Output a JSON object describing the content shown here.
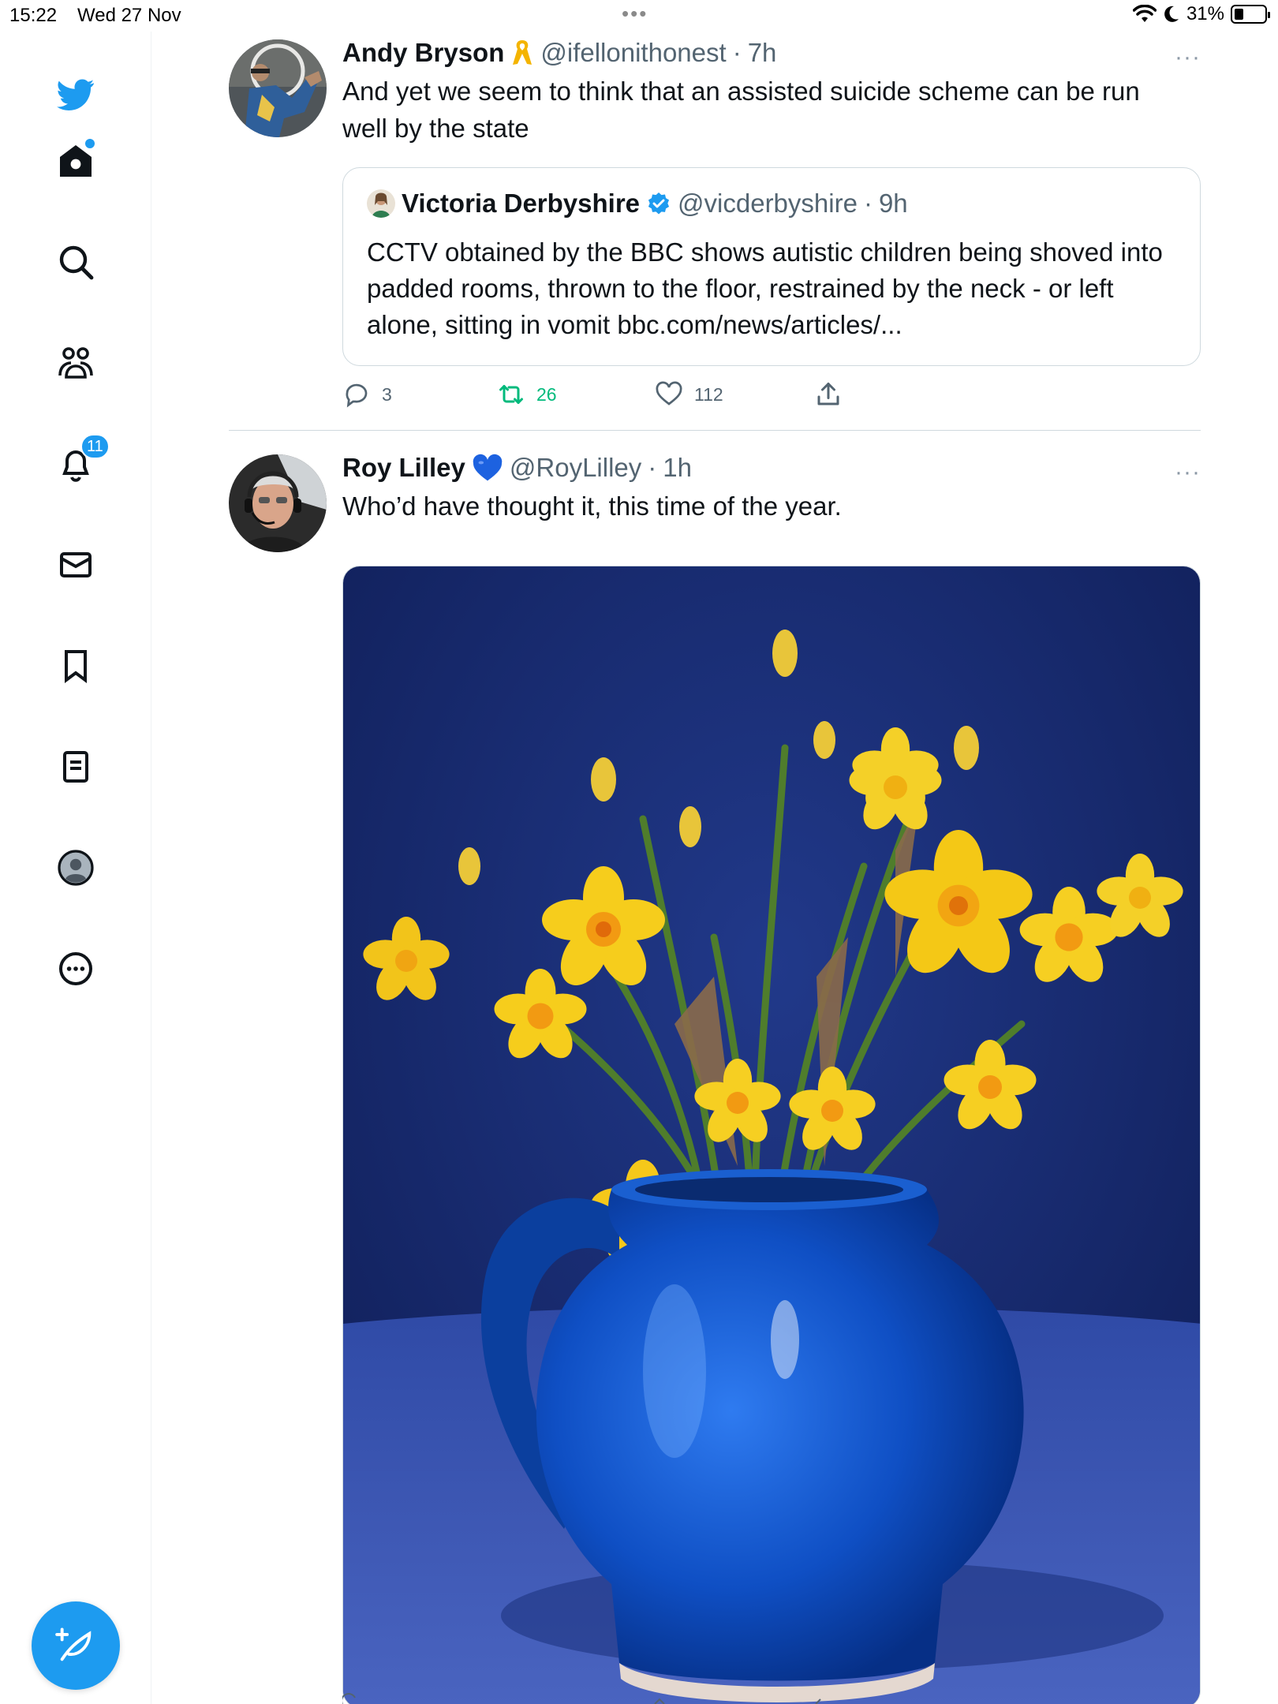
{
  "status_bar": {
    "time": "15:22",
    "date": "Wed 27 Nov",
    "battery": "31%",
    "battery_level": 0.31
  },
  "sidebar": {
    "items": [
      {
        "name": "twitter-logo-icon"
      },
      {
        "name": "home-icon"
      },
      {
        "name": "search-icon"
      },
      {
        "name": "communities-icon"
      },
      {
        "name": "notifications-icon",
        "badge": "11"
      },
      {
        "name": "messages-icon"
      },
      {
        "name": "bookmarks-icon"
      },
      {
        "name": "lists-icon"
      },
      {
        "name": "profile-icon"
      },
      {
        "name": "more-icon"
      }
    ],
    "accent": "#1d9bf0"
  },
  "timeline": {
    "tweets": [
      {
        "name": "Andy Bryson",
        "badge_icon": "ribbon-icon",
        "handle": "@ifellonithonest",
        "separator": "·",
        "time": "7h",
        "more": "···",
        "text": "And yet we seem to think that an assisted suicide scheme can be run well by the state",
        "quote": {
          "name": "Victoria Derbyshire",
          "verified_icon": "verified-badge-icon",
          "handle": "@vicderbyshire",
          "separator": "·",
          "time": "9h",
          "text": "CCTV obtained by the BBC shows autistic children being shoved into padded rooms, thrown to the floor, restrained by the neck - or left alone, sitting in vomit bbc.com/news/articles/..."
        },
        "actions": {
          "replies": "3",
          "retweets": "26",
          "likes": "112"
        }
      },
      {
        "name": "Roy Lilley",
        "badge_icon": "blue-heart-icon",
        "handle": "@RoyLilley",
        "separator": "·",
        "time": "1h",
        "more": "···",
        "text": "Who’d have thought it, this time of the year.",
        "media_icon": "daffodils-in-blue-jug-photo"
      }
    ]
  }
}
